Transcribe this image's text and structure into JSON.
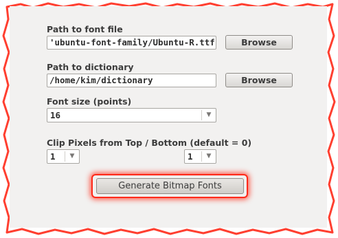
{
  "form": {
    "font_path": {
      "label": "Path to font file",
      "value": "'ubuntu-font-family/Ubuntu-R.ttf",
      "browse_label": "Browse"
    },
    "dictionary_path": {
      "label": "Path to dictionary",
      "value": "/home/kim/dictionary",
      "browse_label": "Browse"
    },
    "font_size": {
      "label": "Font size (points)",
      "value": "16"
    },
    "clip_pixels": {
      "label": "Clip Pixels from Top / Bottom (default = 0)",
      "top_value": "1",
      "bottom_value": "1"
    },
    "generate_label": "Generate Bitmap Fonts"
  },
  "colors": {
    "highlight": "#ff2a1a",
    "panel_bg": "#f2f1f0",
    "frame_border": "#ff2a1a"
  },
  "icons": {
    "dropdown": "chevron-down-icon"
  }
}
